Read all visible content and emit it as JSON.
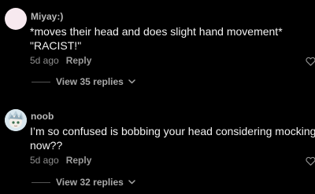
{
  "comments": [
    {
      "username": "Miyay:)",
      "lines": [
        "*moves their head and does slight hand movement*",
        "\"RACIST!\""
      ],
      "time": "5d ago",
      "reply_label": "Reply",
      "view_replies": "View 35 replies"
    },
    {
      "username": "noob",
      "lines": [
        "I’m so confused is bobbing your head considering mocking",
        "now??"
      ],
      "time": "5d ago",
      "reply_label": "Reply",
      "view_replies": "View 32 replies"
    }
  ],
  "colors": {
    "background": "#000000",
    "text": "#f2f2f2",
    "muted": "#8e8e8e"
  },
  "icons": [
    "heart-outline-icon",
    "chevron-down-icon"
  ]
}
